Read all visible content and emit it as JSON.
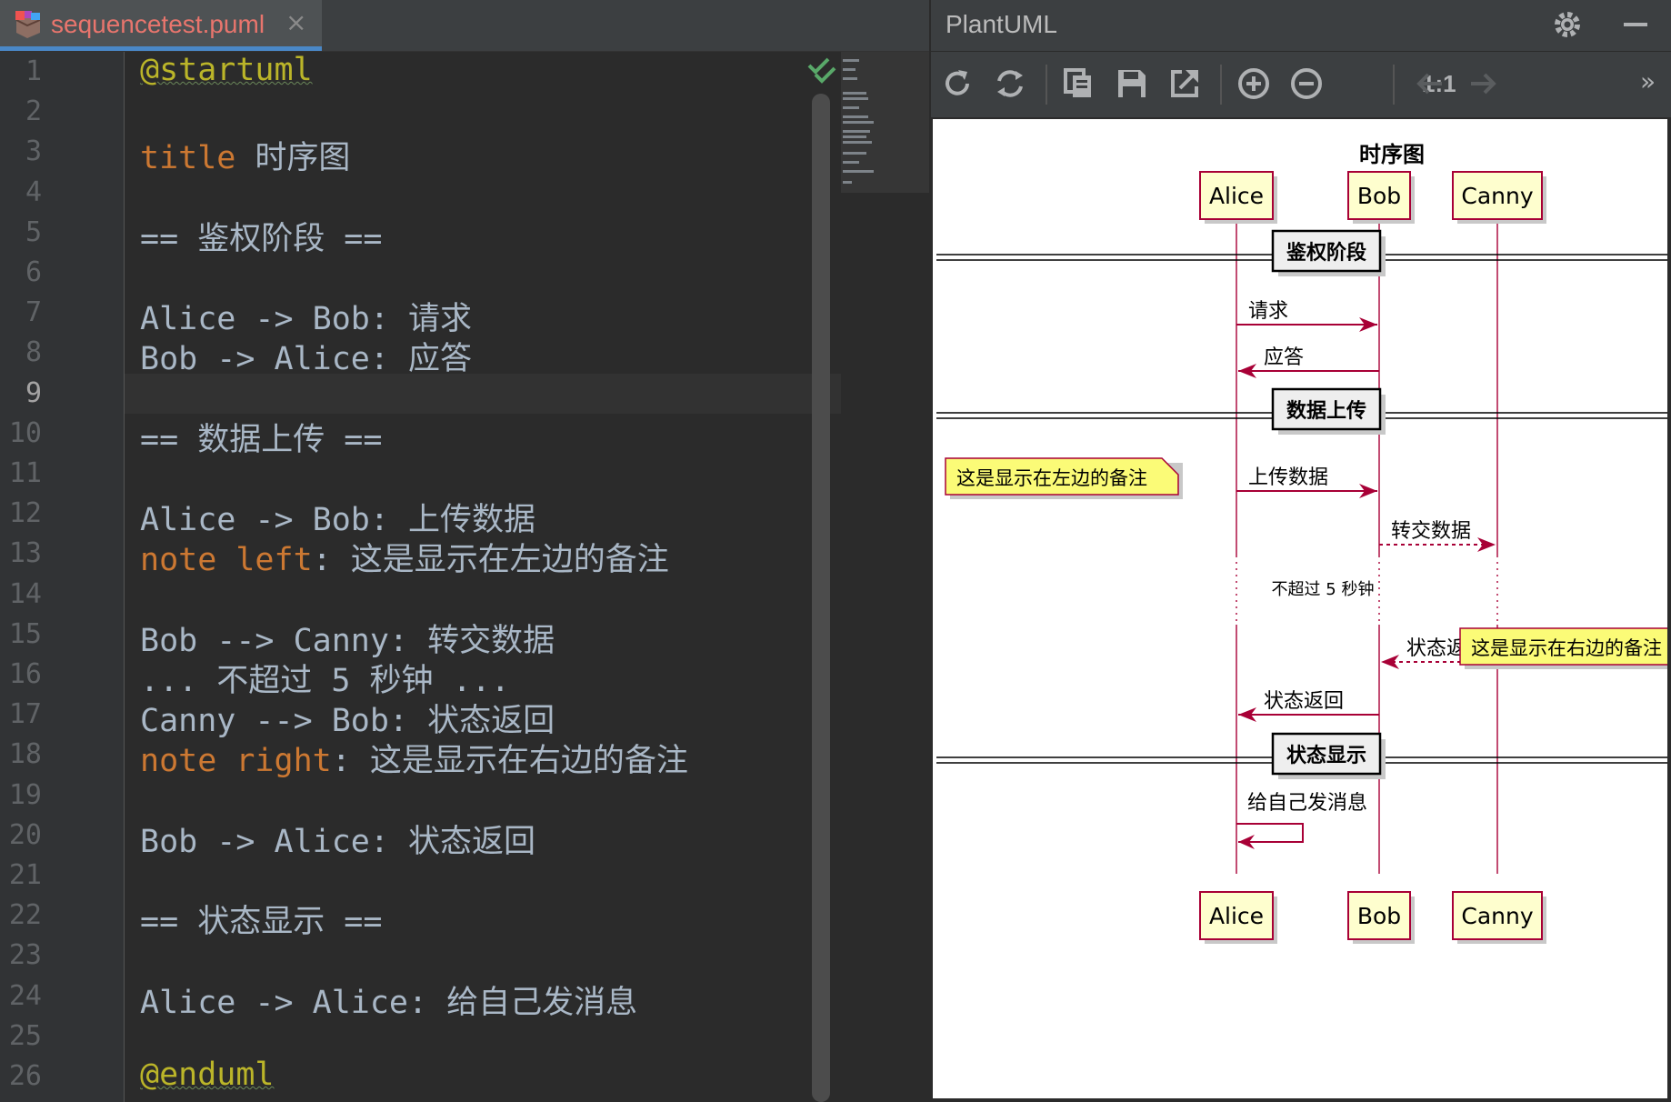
{
  "editor": {
    "tab": {
      "filename": "sequencetest.puml",
      "close": "×"
    },
    "current_line": 9,
    "lines": [
      {
        "n": "1",
        "parts": [
          {
            "t": "@startuml",
            "c": "start"
          }
        ]
      },
      {
        "n": "2",
        "parts": []
      },
      {
        "n": "3",
        "parts": [
          {
            "t": "title",
            "c": "kw"
          },
          {
            "t": " 时序图",
            "c": "plain"
          }
        ]
      },
      {
        "n": "4",
        "parts": []
      },
      {
        "n": "5",
        "parts": [
          {
            "t": "== 鉴权阶段 ==",
            "c": "plain"
          }
        ]
      },
      {
        "n": "6",
        "parts": []
      },
      {
        "n": "7",
        "parts": [
          {
            "t": "Alice -> Bob: 请求",
            "c": "plain"
          }
        ]
      },
      {
        "n": "8",
        "parts": [
          {
            "t": "Bob -> Alice: 应答",
            "c": "plain"
          }
        ]
      },
      {
        "n": "9",
        "parts": []
      },
      {
        "n": "10",
        "parts": [
          {
            "t": "== 数据上传 ==",
            "c": "plain"
          }
        ]
      },
      {
        "n": "11",
        "parts": []
      },
      {
        "n": "12",
        "parts": [
          {
            "t": "Alice -> Bob: 上传数据",
            "c": "plain"
          }
        ]
      },
      {
        "n": "13",
        "parts": [
          {
            "t": "note left",
            "c": "kw"
          },
          {
            "t": ": 这是显示在左边的备注",
            "c": "plain"
          }
        ]
      },
      {
        "n": "14",
        "parts": []
      },
      {
        "n": "15",
        "parts": [
          {
            "t": "Bob --> Canny: 转交数据",
            "c": "plain"
          }
        ]
      },
      {
        "n": "16",
        "parts": [
          {
            "t": "... 不超过 5 秒钟 ...",
            "c": "plain"
          }
        ]
      },
      {
        "n": "17",
        "parts": [
          {
            "t": "Canny --> Bob: 状态返回",
            "c": "plain"
          }
        ]
      },
      {
        "n": "18",
        "parts": [
          {
            "t": "note right",
            "c": "kw"
          },
          {
            "t": ": 这是显示在右边的备注",
            "c": "plain"
          }
        ]
      },
      {
        "n": "19",
        "parts": []
      },
      {
        "n": "20",
        "parts": [
          {
            "t": "Bob -> Alice: 状态返回",
            "c": "plain"
          }
        ]
      },
      {
        "n": "21",
        "parts": []
      },
      {
        "n": "22",
        "parts": [
          {
            "t": "== 状态显示 ==",
            "c": "plain"
          }
        ]
      },
      {
        "n": "23",
        "parts": []
      },
      {
        "n": "24",
        "parts": [
          {
            "t": "Alice -> Alice: 给自己发消息",
            "c": "plain"
          }
        ]
      },
      {
        "n": "25",
        "parts": []
      },
      {
        "n": "26",
        "parts": [
          {
            "t": "@enduml",
            "c": "start"
          }
        ]
      }
    ]
  },
  "plantuml_panel": {
    "title": "PlantUML",
    "toolbar_icons": [
      "refresh-icon",
      "sync-icon",
      "copy-icon",
      "save-icon",
      "export-icon",
      "zoom-in-icon",
      "zoom-out-icon",
      "actual-size",
      "back-icon",
      "forward-icon",
      "more-icon"
    ],
    "zoom_actual_label": "1:1",
    "more_label": "»"
  },
  "diagram": {
    "title": "时序图",
    "participants": [
      "Alice",
      "Bob",
      "Canny"
    ],
    "dividers": [
      "鉴权阶段",
      "数据上传",
      "状态显示"
    ],
    "messages": [
      {
        "from": "Alice",
        "to": "Bob",
        "label": "请求",
        "style": "solid"
      },
      {
        "from": "Bob",
        "to": "Alice",
        "label": "应答",
        "style": "solid"
      },
      {
        "from": "Alice",
        "to": "Bob",
        "label": "上传数据",
        "style": "solid"
      },
      {
        "from": "Bob",
        "to": "Canny",
        "label": "转交数据",
        "style": "dashed"
      },
      {
        "from": "Canny",
        "to": "Bob",
        "label": "状态返回",
        "style": "dashed"
      },
      {
        "from": "Bob",
        "to": "Alice",
        "label": "状态返回",
        "style": "solid"
      },
      {
        "from": "Alice",
        "to": "Alice",
        "label": "给自己发消息",
        "style": "solid"
      }
    ],
    "delay_label": "不超过 5 秒钟",
    "notes": [
      {
        "text": "这是显示在左边的备注",
        "side": "left"
      },
      {
        "text": "这是显示在右边的备注",
        "side": "right"
      }
    ],
    "colors": {
      "participant_fill": "#fefece",
      "participant_border": "#a80036",
      "line": "#a80036",
      "note_fill": "#fbfb77"
    }
  }
}
